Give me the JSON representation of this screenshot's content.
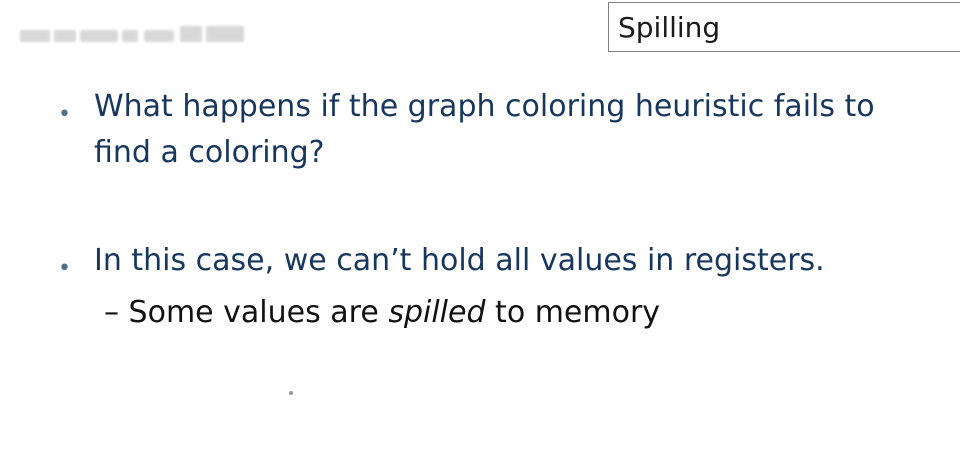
{
  "slide": {
    "title": "Spilling",
    "bullets": [
      {
        "text": "What happens if the graph coloring heuristic fails to find a coloring?"
      },
      {
        "text": "In this case, we can’t hold all values in registers."
      }
    ],
    "sub_bullet": {
      "dash": "–",
      "before": "Some values are ",
      "emphasis": "spilled",
      "after": " to memory"
    },
    "bullet_glyph": "•",
    "colors": {
      "bullet_text": "#17375e",
      "sub_text": "#111111",
      "title_border": "#7f7f7f"
    }
  }
}
